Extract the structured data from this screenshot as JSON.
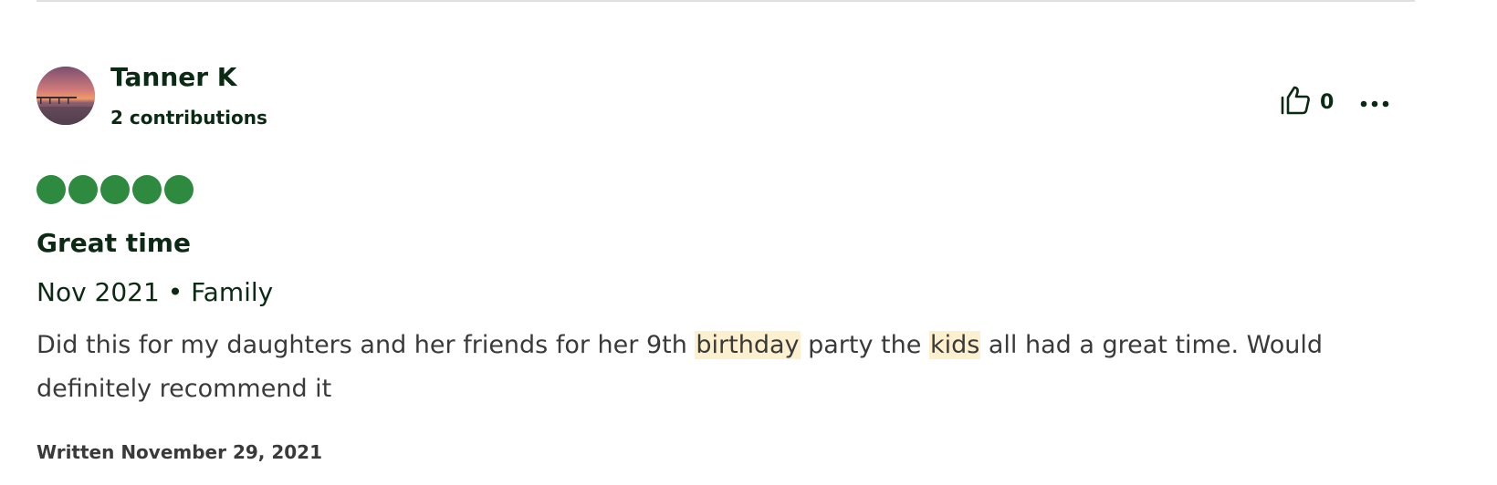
{
  "review": {
    "user": {
      "name": "Tanner K",
      "contributions": "2 contributions",
      "avatar_icon": "avatar-sunset-pier-photo"
    },
    "helpful": {
      "icon": "thumbs-up-icon",
      "count": "0"
    },
    "more_icon": "more-options-icon",
    "rating": {
      "value": 5,
      "max": 5,
      "color": "#2d8a3e"
    },
    "title": "Great time",
    "meta": "Nov 2021 • Family",
    "body": {
      "part1": "Did this for my daughters and her friends for her 9th ",
      "highlight1": "birthday",
      "part2": " party the ",
      "highlight2": "kids",
      "part3": " all had a great time. Would definitely recommend it"
    },
    "written": "Written November 29, 2021"
  }
}
